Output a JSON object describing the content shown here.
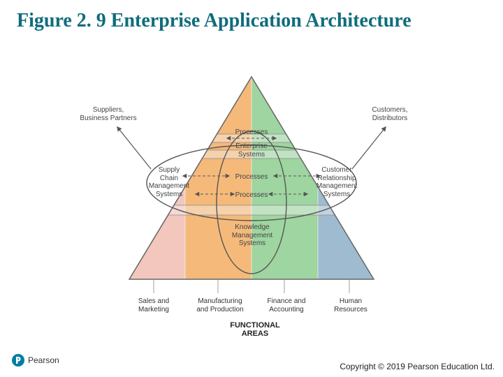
{
  "title": "Figure 2. 9 Enterprise Application Architecture",
  "labels": {
    "suppliers": "Suppliers,\nBusiness Partners",
    "customers": "Customers,\nDistributors",
    "scm": "Supply\nChain\nManagement\nSystems",
    "crm": "Customer\nRelationship\nManagement\nSystems",
    "processes_top": "Processes",
    "enterprise": "Enterprise\nSystems",
    "processes_mid": "Processes",
    "processes_low": "Processes",
    "kms": "Knowledge\nManagement\nSystems"
  },
  "functional_columns": [
    "Sales and\nMarketing",
    "Manufacturing\nand Production",
    "Finance and\nAccounting",
    "Human\nResources"
  ],
  "functional_areas": "FUNCTIONAL\nAREAS",
  "publisher": "Pearson",
  "copyright": "Copyright © 2019 Pearson Education Ltd."
}
